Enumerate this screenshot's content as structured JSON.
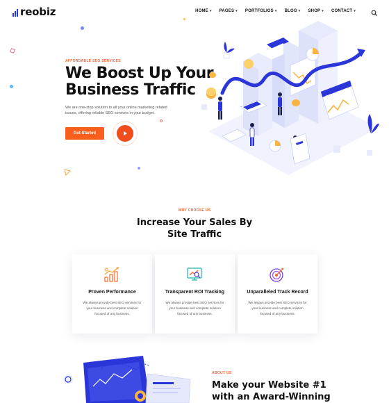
{
  "brand": {
    "name": "reobiz",
    "accent": "#2a36d8",
    "orange": "#f85e1c"
  },
  "nav": {
    "items": [
      {
        "label": "HOME"
      },
      {
        "label": "PAGES"
      },
      {
        "label": "PORTFOLIOS"
      },
      {
        "label": "BLOG"
      },
      {
        "label": "SHOP"
      },
      {
        "label": "CONTACT"
      }
    ],
    "search_icon": "search-icon"
  },
  "hero": {
    "eyebrow": "AFFORDABLE SEO SERVICES",
    "title_line1": "We Boost Up Your",
    "title_line2": "Business Traffic",
    "description": "We are one-stop solution to all your online marketing related issues, offering reliable SEO services in your budget.",
    "cta_label": "Get Started",
    "play_icon": "play-icon",
    "illustration_label": "https://..."
  },
  "why": {
    "eyebrow": "WHY CHOOSE US",
    "title_line1": "Increase Your Sales By",
    "title_line2": "Site Traffic",
    "cards": [
      {
        "title": "Proven Performance",
        "icon": "performance-chart-icon",
        "desc": "We always provide best SEO services for your business and complete solution focused of any business."
      },
      {
        "title": "Transparent ROI Tracking",
        "icon": "roi-tracking-icon",
        "desc": "We always provide best SEO services for your business and complete solution focused of any business."
      },
      {
        "title": "Unparalleled Track Record",
        "icon": "target-icon",
        "desc": "We always provide best SEO services for your business and complete solution focused of any business."
      }
    ]
  },
  "about": {
    "eyebrow": "ABOUT US",
    "title_line1": "Make your Website #1",
    "title_line2": "with an Award-Winning"
  }
}
